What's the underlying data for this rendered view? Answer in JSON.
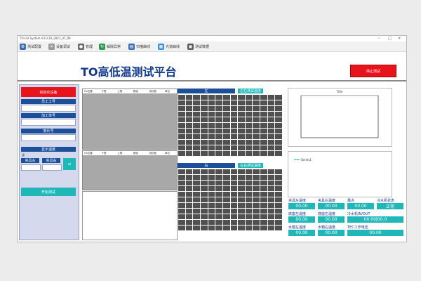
{
  "window": {
    "title": "TO-LIV System V3.0.20_2021_07_09"
  },
  "toolbar": [
    {
      "label": "测试配置",
      "color": "#3b6db3",
      "icon": "gear-icon"
    },
    {
      "label": "设备调试",
      "color": "#9a9a9a",
      "icon": "tools-icon"
    },
    {
      "label": "管理",
      "color": "#6a6a6a",
      "icon": "user-icon"
    },
    {
      "label": "解除异常",
      "color": "#2e9a4a",
      "icon": "refresh-icon"
    },
    {
      "label": "扫描曲线",
      "color": "#3b6db3",
      "icon": "chart-icon"
    },
    {
      "label": "光谱曲线",
      "color": "#3b8fd6",
      "icon": "spectrum-icon"
    },
    {
      "label": "测试数据",
      "color": "#5b5b5b",
      "icon": "data-icon"
    }
  ],
  "header": {
    "title": "TO高低温测试平台",
    "stop_label": "停止测试"
  },
  "left": {
    "init_label": "初始化设备",
    "worker_label": "员工工号",
    "order_label": "加工单号",
    "cart_label": "架片号",
    "temp_header": "显示温度",
    "left_temp": "夹具左",
    "right_temp": "夹具右",
    "start_label": "开始测试"
  },
  "tables": {
    "tabs": [
      "测量",
      "数据"
    ],
    "columns": [
      "Fix位置",
      "下限",
      "上限",
      "数值",
      "测试值",
      "单位"
    ]
  },
  "grids": {
    "left_title": "左",
    "right_title": "右",
    "badge": "左右测试温度"
  },
  "chart_data": {
    "type": "line",
    "title": "Title",
    "series": []
  },
  "bottom_tabs": [
    "Panel",
    "Panel",
    "Panel",
    "Panel",
    "Panel",
    "图表"
  ],
  "legend": "Series1",
  "readouts": [
    {
      "label": "夹具左温度",
      "value": "00.00"
    },
    {
      "label": "夹具右温度",
      "value": "00.00"
    },
    {
      "label": "露点",
      "value": "00.00"
    },
    {
      "label": "冷水机状态",
      "value": "正常"
    },
    {
      "label": "底座左温度",
      "value": "00.00"
    },
    {
      "label": "底座右温度",
      "value": "00.00"
    },
    {
      "label": "冷水机IN/OUT",
      "value": "00.00|00.0"
    },
    {
      "label": "水箱左温度",
      "value": "00.00"
    },
    {
      "label": "水箱右温度",
      "value": "00.00"
    },
    {
      "label": "TEC工作电压",
      "value": "00.00"
    }
  ]
}
